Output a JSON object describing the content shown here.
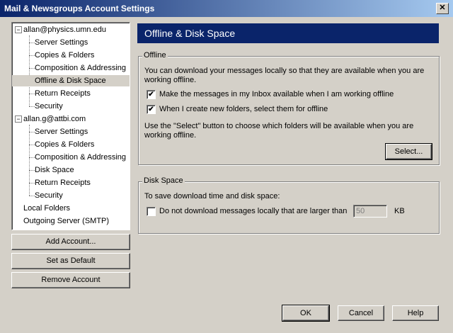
{
  "window": {
    "title": "Mail & Newsgroups Account Settings",
    "close_glyph": "✕"
  },
  "tree": {
    "accounts": [
      {
        "name": "allan@physics.umn.edu",
        "expander": "−",
        "items": [
          "Server Settings",
          "Copies & Folders",
          "Composition & Addressing",
          "Offline & Disk Space",
          "Return Receipts",
          "Security"
        ]
      },
      {
        "name": "allan.g@attbi.com",
        "expander": "−",
        "items": [
          "Server Settings",
          "Copies & Folders",
          "Composition & Addressing",
          "Disk Space",
          "Return Receipts",
          "Security"
        ]
      }
    ],
    "other": [
      "Local Folders",
      "Outgoing Server (SMTP)"
    ]
  },
  "left_buttons": {
    "add": "Add Account...",
    "default": "Set as Default",
    "remove": "Remove Account"
  },
  "panel": {
    "title": "Offline & Disk Space"
  },
  "offline": {
    "legend": "Offline",
    "intro_line1": "You can download your messages locally so that they are available when you are",
    "intro_line2": "working offline.",
    "check1": {
      "label": "Make the messages in my Inbox available when I am working offline",
      "checked": "✔"
    },
    "check2": {
      "label": "When I create new folders, select them for offline",
      "checked": "✔"
    },
    "select_line1": "Use the \"Select\" button to choose which folders will be available when you are",
    "select_line2": "working offline.",
    "select_button": "Select..."
  },
  "disk": {
    "legend": "Disk Space",
    "intro": "To save download time and disk space:",
    "check_label": "Do not download messages locally that are larger than",
    "size_value": "50",
    "unit": "KB"
  },
  "footer": {
    "ok": "OK",
    "cancel": "Cancel",
    "help": "Help"
  }
}
